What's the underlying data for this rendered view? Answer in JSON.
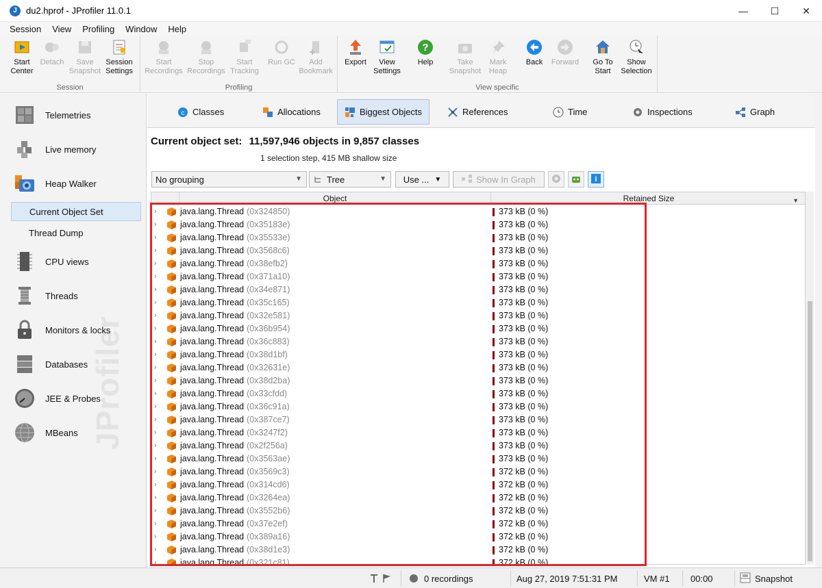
{
  "window": {
    "title": "du2.hprof - JProfiler 11.0.1",
    "controls": [
      "—",
      "☐",
      "✕"
    ]
  },
  "menu": [
    "Session",
    "View",
    "Profiling",
    "Window",
    "Help"
  ],
  "toolbar": {
    "groups": {
      "session": "Session",
      "profiling": "Profiling",
      "view_specific": "View specific"
    },
    "buttons": {
      "start_center": [
        "Start",
        "Center"
      ],
      "detach": [
        "Detach",
        ""
      ],
      "save_snapshot": [
        "Save",
        "Snapshot"
      ],
      "session_settings": [
        "Session",
        "Settings"
      ],
      "start_recordings": [
        "Start",
        "Recordings"
      ],
      "stop_recordings": [
        "Stop",
        "Recordings"
      ],
      "start_tracking": [
        "Start",
        "Tracking"
      ],
      "run_gc": [
        "Run GC",
        ""
      ],
      "add_bookmark": [
        "Add",
        "Bookmark"
      ],
      "export": [
        "Export",
        ""
      ],
      "view_settings": [
        "View",
        "Settings"
      ],
      "help": [
        "Help",
        ""
      ],
      "take_snapshot": [
        "Take",
        "Snapshot"
      ],
      "mark_heap": [
        "Mark",
        "Heap"
      ],
      "back": [
        "Back",
        ""
      ],
      "forward": [
        "Forward",
        ""
      ],
      "go_to_start": [
        "Go To",
        "Start"
      ],
      "show_selection": [
        "Show",
        "Selection"
      ]
    }
  },
  "sidebar": {
    "telemetries": "Telemetries",
    "live_memory": "Live memory",
    "heap_walker": "Heap Walker",
    "current_object_set": "Current Object Set",
    "thread_dump": "Thread Dump",
    "cpu_views": "CPU views",
    "threads": "Threads",
    "monitors_locks": "Monitors & locks",
    "databases": "Databases",
    "jee_probes": "JEE & Probes",
    "mbeans": "MBeans",
    "watermark": "JProfiler"
  },
  "tabs": {
    "classes": "Classes",
    "allocations": "Allocations",
    "biggest_objects": "Biggest Objects",
    "references": "References",
    "time": "Time",
    "inspections": "Inspections",
    "graph": "Graph"
  },
  "content": {
    "title_label": "Current object set:",
    "title_value": "11,597,946 objects in 9,857 classes",
    "subtitle": "1 selection step, 415 MB shallow size"
  },
  "filters": {
    "grouping": "No grouping",
    "view_mode": "Tree",
    "use_label": "Use ...",
    "show_in_graph": "Show In Graph"
  },
  "table": {
    "columns": {
      "object": "Object",
      "retained_size": "Retained Size"
    },
    "rows": [
      {
        "cls": "java.lang.Thread",
        "addr": "(0x324850)",
        "size": "373 kB (0 %)"
      },
      {
        "cls": "java.lang.Thread",
        "addr": "(0x35183e)",
        "size": "373 kB (0 %)"
      },
      {
        "cls": "java.lang.Thread",
        "addr": "(0x35533e)",
        "size": "373 kB (0 %)"
      },
      {
        "cls": "java.lang.Thread",
        "addr": "(0x3568c6)",
        "size": "373 kB (0 %)"
      },
      {
        "cls": "java.lang.Thread",
        "addr": "(0x38efb2)",
        "size": "373 kB (0 %)"
      },
      {
        "cls": "java.lang.Thread",
        "addr": "(0x371a10)",
        "size": "373 kB (0 %)"
      },
      {
        "cls": "java.lang.Thread",
        "addr": "(0x34e871)",
        "size": "373 kB (0 %)"
      },
      {
        "cls": "java.lang.Thread",
        "addr": "(0x35c165)",
        "size": "373 kB (0 %)"
      },
      {
        "cls": "java.lang.Thread",
        "addr": "(0x32e581)",
        "size": "373 kB (0 %)"
      },
      {
        "cls": "java.lang.Thread",
        "addr": "(0x36b954)",
        "size": "373 kB (0 %)"
      },
      {
        "cls": "java.lang.Thread",
        "addr": "(0x36c883)",
        "size": "373 kB (0 %)"
      },
      {
        "cls": "java.lang.Thread",
        "addr": "(0x38d1bf)",
        "size": "373 kB (0 %)"
      },
      {
        "cls": "java.lang.Thread",
        "addr": "(0x32631e)",
        "size": "373 kB (0 %)"
      },
      {
        "cls": "java.lang.Thread",
        "addr": "(0x38d2ba)",
        "size": "373 kB (0 %)"
      },
      {
        "cls": "java.lang.Thread",
        "addr": "(0x33cfdd)",
        "size": "373 kB (0 %)"
      },
      {
        "cls": "java.lang.Thread",
        "addr": "(0x36c91a)",
        "size": "373 kB (0 %)"
      },
      {
        "cls": "java.lang.Thread",
        "addr": "(0x387ce7)",
        "size": "373 kB (0 %)"
      },
      {
        "cls": "java.lang.Thread",
        "addr": "(0x3247f2)",
        "size": "373 kB (0 %)"
      },
      {
        "cls": "java.lang.Thread",
        "addr": "(0x2f256a)",
        "size": "373 kB (0 %)"
      },
      {
        "cls": "java.lang.Thread",
        "addr": "(0x3563ae)",
        "size": "373 kB (0 %)"
      },
      {
        "cls": "java.lang.Thread",
        "addr": "(0x3569c3)",
        "size": "372 kB (0 %)"
      },
      {
        "cls": "java.lang.Thread",
        "addr": "(0x314cd6)",
        "size": "372 kB (0 %)"
      },
      {
        "cls": "java.lang.Thread",
        "addr": "(0x3264ea)",
        "size": "372 kB (0 %)"
      },
      {
        "cls": "java.lang.Thread",
        "addr": "(0x3552b6)",
        "size": "372 kB (0 %)"
      },
      {
        "cls": "java.lang.Thread",
        "addr": "(0x37e2ef)",
        "size": "372 kB (0 %)"
      },
      {
        "cls": "java.lang.Thread",
        "addr": "(0x389a16)",
        "size": "372 kB (0 %)"
      },
      {
        "cls": "java.lang.Thread",
        "addr": "(0x38d1e3)",
        "size": "372 kB (0 %)"
      },
      {
        "cls": "java.lang.Thread",
        "addr": "(0x321c81)",
        "size": "372 kB (0 %)"
      }
    ]
  },
  "status": {
    "recordings": "0 recordings",
    "timestamp": "Aug 27, 2019 7:51:31 PM",
    "vm": "VM #1",
    "elapsed": "00:00",
    "mode": "Snapshot"
  },
  "colors": {
    "accent": "#1f6fc0",
    "highlight": "#e0262a",
    "size_bar": "#8b0000",
    "object_icon": "#f08c1c"
  },
  "icons": {
    "app": "jprofiler-logo-icon",
    "object": "cube-icon",
    "expand": "chevron-right-icon"
  }
}
